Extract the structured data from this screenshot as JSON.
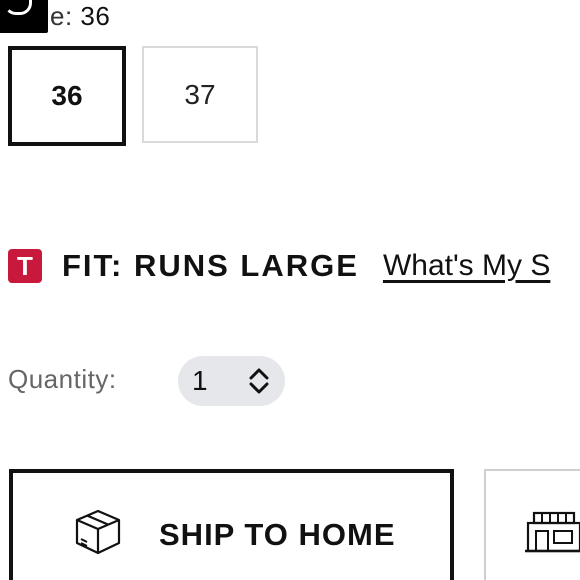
{
  "size": {
    "label": "e:",
    "selected_value": "36",
    "options": [
      {
        "label": "36",
        "selected": true
      },
      {
        "label": "37",
        "selected": false
      }
    ]
  },
  "fit": {
    "badge": "T",
    "badge_color": "#c8193c",
    "text": "FIT: RUNS LARGE",
    "link": "What's My S"
  },
  "quantity": {
    "label": "Quantity:",
    "value": "1",
    "icon": "chevron-up-down-icon"
  },
  "actions": {
    "ship_label": "SHIP TO HOME",
    "ship_icon": "package-icon",
    "store_icon": "store-icon"
  }
}
